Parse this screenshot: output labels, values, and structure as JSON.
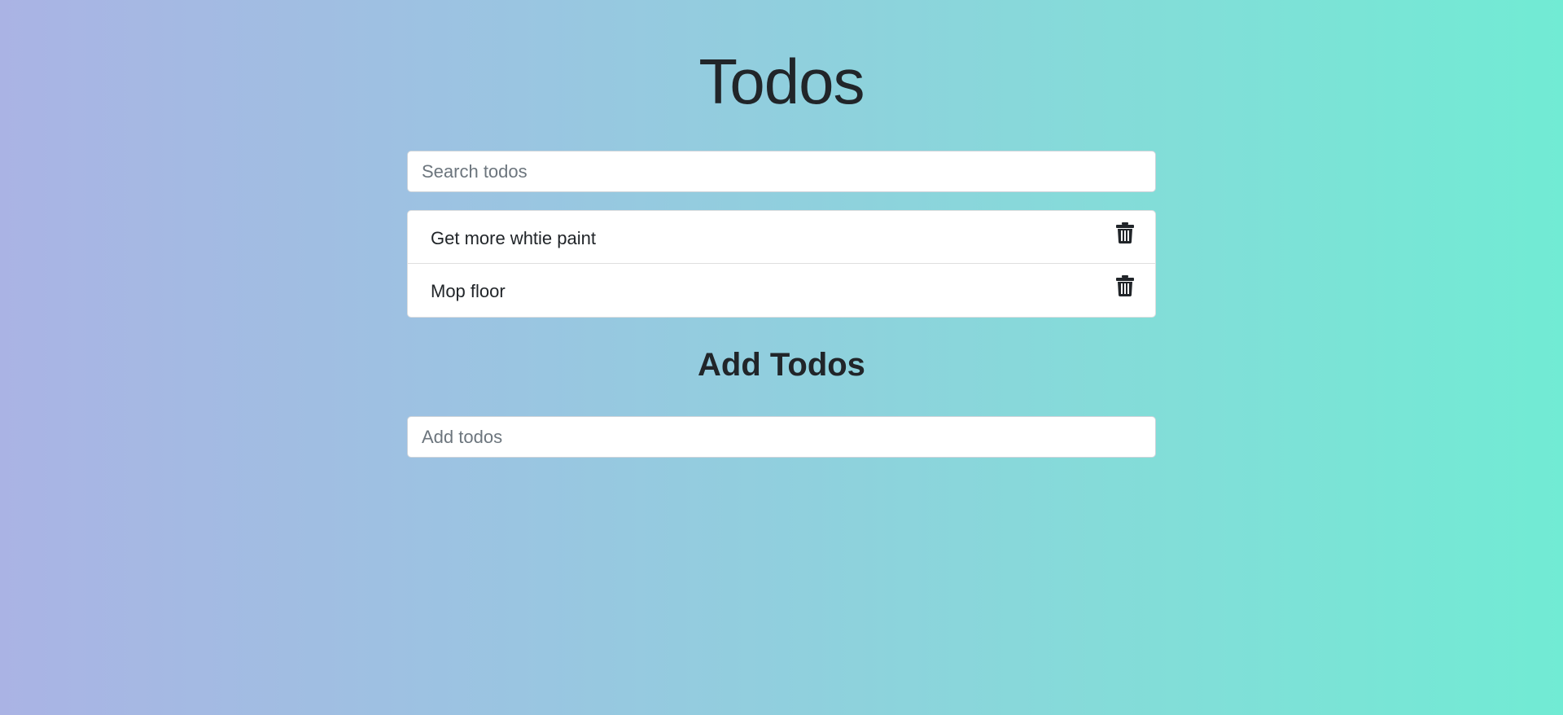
{
  "header": {
    "title": "Todos"
  },
  "search": {
    "placeholder": "Search todos",
    "value": ""
  },
  "todos": {
    "items": [
      {
        "text": "Get more whtie paint",
        "delete_icon": "trash-icon"
      },
      {
        "text": "Mop floor",
        "delete_icon": "trash-icon"
      }
    ]
  },
  "add_section": {
    "title": "Add Todos",
    "placeholder": "Add todos",
    "value": ""
  },
  "colors": {
    "gradient_start": "#aab3e4",
    "gradient_end": "#71ebd4",
    "text": "#212529",
    "card_background": "#ffffff"
  }
}
